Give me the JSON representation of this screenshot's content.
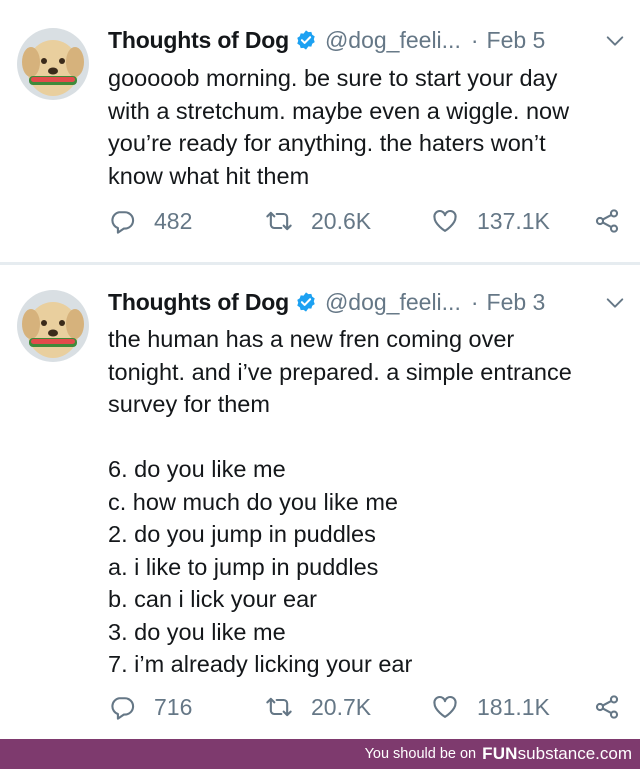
{
  "tweets": [
    {
      "name": "Thoughts of Dog",
      "handle": "@dog_feeli...",
      "separator": "·",
      "date": "Feb 5",
      "lines": [
        "gooooob morning. be sure to start your day",
        "with a stretchum. maybe even a wiggle. now",
        "you’re ready for anything. the haters won’t",
        "know what hit them"
      ],
      "replies": "482",
      "retweets": "20.6K",
      "likes": "137.1K"
    },
    {
      "name": "Thoughts of Dog",
      "handle": "@dog_feeli...",
      "separator": "·",
      "date": "Feb 3",
      "lines": [
        "the human has a new fren coming over",
        "tonight. and i’ve prepared. a simple entrance",
        "survey for them",
        "",
        "6. do you like me",
        "c. how much do you like me",
        "2. do you jump in puddles",
        "a. i like to jump in puddles",
        "b. can i lick your ear",
        "3. do you like me",
        "7. i’m already licking your ear"
      ],
      "replies": "716",
      "retweets": "20.7K",
      "likes": "181.1K"
    }
  ],
  "footer": {
    "prefix": "You should be on",
    "brand": "FUN",
    "brand_rest": "substance.com"
  },
  "icons": {
    "verified": "verified-badge-icon",
    "chevron": "chevron-down-icon",
    "reply": "reply-icon",
    "retweet": "retweet-icon",
    "like": "heart-icon",
    "share": "share-icon"
  },
  "colors": {
    "text": "#14171a",
    "muted": "#657786",
    "verified": "#1da1f2",
    "divider": "#e6ecf0",
    "footer_bg": "#7e3a6e"
  }
}
